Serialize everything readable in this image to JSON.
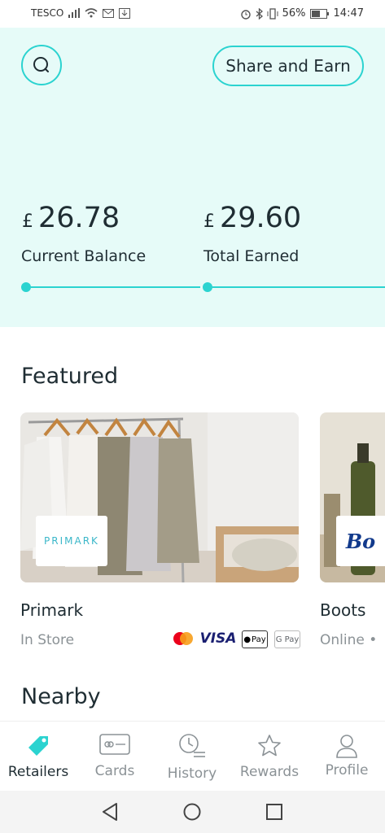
{
  "status_bar": {
    "carrier": "TESCO",
    "battery": "56%",
    "time": "14:47"
  },
  "header": {
    "share_label": "Share and Earn",
    "currency": "£",
    "current_balance": "26.78",
    "current_balance_label": "Current Balance",
    "total_earned": "29.60",
    "total_earned_label": "Total Earned"
  },
  "featured": {
    "title": "Featured",
    "cards": [
      {
        "name": "Primark",
        "type": "In Store",
        "logo_text": "PRIMARK",
        "payment_methods": [
          "mastercard-icon",
          "VISA",
          "Pay",
          "G Pay"
        ]
      },
      {
        "name": "Boots",
        "type": "Online •",
        "logo_text": "Bo"
      }
    ]
  },
  "nearby": {
    "title": "Nearby"
  },
  "bottom_nav": {
    "items": [
      {
        "label": "Retailers",
        "icon": "tag-icon",
        "active": true
      },
      {
        "label": "Cards",
        "icon": "card-icon",
        "active": false
      },
      {
        "label": "History",
        "icon": "history-icon",
        "active": false
      },
      {
        "label": "Rewards",
        "icon": "star-icon",
        "active": false
      },
      {
        "label": "Profile",
        "icon": "person-icon",
        "active": false
      }
    ]
  },
  "colors": {
    "accent": "#2bd3d0",
    "header_bg": "#e6fbf8",
    "text": "#1f2d33",
    "muted": "#8b9296"
  }
}
